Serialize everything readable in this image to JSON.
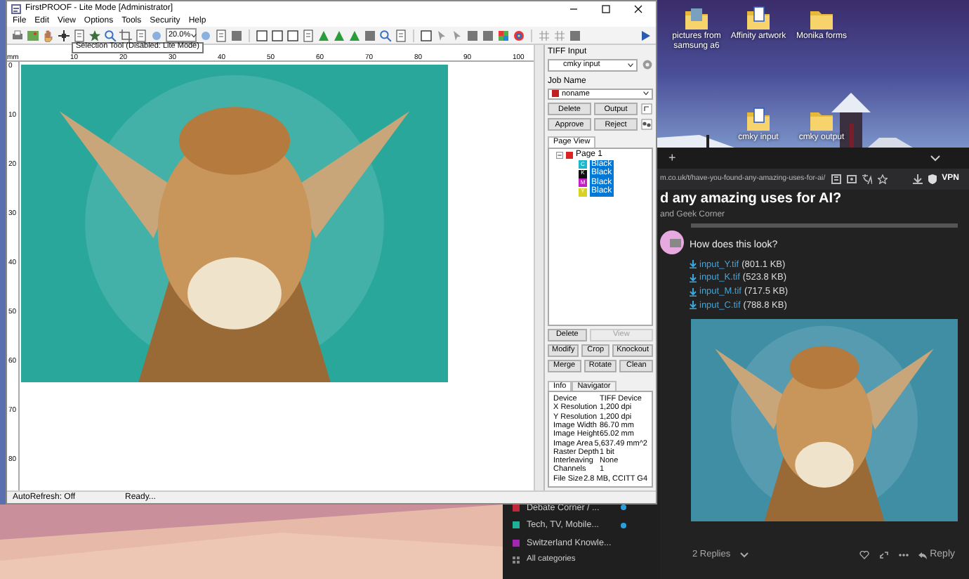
{
  "desktop_icons": [
    {
      "label": "pictures from samsung a6",
      "kind": "photo-folder"
    },
    {
      "label": "Affinity artwork",
      "kind": "doc-folder"
    },
    {
      "label": "Monika forms",
      "kind": "folder"
    },
    {
      "label": "cmky input",
      "kind": "doc-folder"
    },
    {
      "label": "cmky output",
      "kind": "folder"
    }
  ],
  "firstproof": {
    "title": "FirstPROOF - Lite Mode [Administrator]",
    "menu": [
      "File",
      "Edit",
      "View",
      "Options",
      "Tools",
      "Security",
      "Help"
    ],
    "zoom": "20.0%",
    "tooltip": "Selection Tool (Disabled: Lite Mode)",
    "ruler": {
      "unit": "mm",
      "horizontal": [
        "10",
        "20",
        "30",
        "40",
        "50",
        "60",
        "70",
        "80",
        "90",
        "100"
      ],
      "vertical": [
        "0",
        "10",
        "20",
        "30",
        "40",
        "50",
        "60",
        "70",
        "80"
      ]
    },
    "panel": {
      "tiff_input": {
        "label": "TIFF Input",
        "value": "cmky input"
      },
      "job_name": {
        "label": "Job Name",
        "value": "noname"
      },
      "job_buttons": [
        {
          "buttons": [
            "Delete",
            "Output"
          ]
        },
        {
          "buttons": [
            "Approve",
            "Reject"
          ]
        }
      ],
      "page_view": {
        "tab": "Page View",
        "tree": [
          {
            "label": "Page 1",
            "expanded": true,
            "children": [
              {
                "label": "Black",
                "swatch": "C",
                "color": "#20b6c9",
                "selected": true
              },
              {
                "label": "Black",
                "swatch": "K",
                "color": "#111111",
                "selected": true
              },
              {
                "label": "Black",
                "swatch": "M",
                "color": "#c21fc4",
                "selected": true
              },
              {
                "label": "Black",
                "swatch": "Y",
                "color": "#d8d224",
                "selected": true
              }
            ]
          }
        ]
      },
      "page_buttons": [
        {
          "buttons": [
            {
              "label": "Delete",
              "disabled": false
            },
            {
              "label": "View",
              "disabled": true
            }
          ]
        },
        {
          "buttons": [
            {
              "label": "Modify",
              "disabled": false
            },
            {
              "label": "Crop",
              "disabled": false
            },
            {
              "label": "Knockout",
              "disabled": false
            }
          ]
        },
        {
          "buttons": [
            {
              "label": "Merge",
              "disabled": false
            },
            {
              "label": "Rotate",
              "disabled": false
            },
            {
              "label": "Clean",
              "disabled": false
            }
          ]
        }
      ],
      "info_tabs": [
        {
          "label": "Info",
          "selected": true
        },
        {
          "label": "Navigator",
          "selected": false
        }
      ],
      "info": [
        {
          "name": "Device",
          "value": "TIFF Device"
        },
        {
          "name": "X Resolution",
          "value": "1,200 dpi"
        },
        {
          "name": "Y Resolution",
          "value": "1,200 dpi"
        },
        {
          "name": "Image Width",
          "value": "86.70 mm"
        },
        {
          "name": "Image Height",
          "value": "65.02 mm"
        },
        {
          "name": "Image Area",
          "value": "5,637.49 mm^2"
        },
        {
          "name": "Raster Depth",
          "value": "1 bit"
        },
        {
          "name": "Interleaving",
          "value": "None"
        },
        {
          "name": "Channels",
          "value": "1"
        },
        {
          "name": "File Size",
          "value": "2.8 MB, CCITT G4"
        }
      ]
    },
    "status": [
      "AutoRefresh: Off",
      "Ready..."
    ]
  },
  "browser": {
    "tab_plus": "+",
    "url": "m.co.uk/t/have-you-found-any-amazing-uses-for-ai/",
    "vpn": "VPN",
    "topic_title": "d any amazing uses for AI?",
    "category": "and Geek Corner",
    "post": {
      "text": "How does this look?",
      "attachments": [
        {
          "name": "input_Y.tif",
          "size": "(801.1 KB)"
        },
        {
          "name": "input_K.tif",
          "size": "(523.8 KB)"
        },
        {
          "name": "input_M.tif",
          "size": "(717.5 KB)"
        },
        {
          "name": "input_C.tif",
          "size": "(788.8 KB)"
        }
      ],
      "replies": "2 Replies",
      "reply": "Reply"
    },
    "categories": [
      {
        "label": "Debate Corner / ...",
        "color": "#c0283a",
        "unread": true
      },
      {
        "label": "Tech, TV, Mobile...",
        "color": "#1fb09a",
        "unread": true
      },
      {
        "label": "Switzerland Knowle...",
        "color": "#a226b0",
        "unread": false
      }
    ],
    "all_categories": "All categories"
  }
}
